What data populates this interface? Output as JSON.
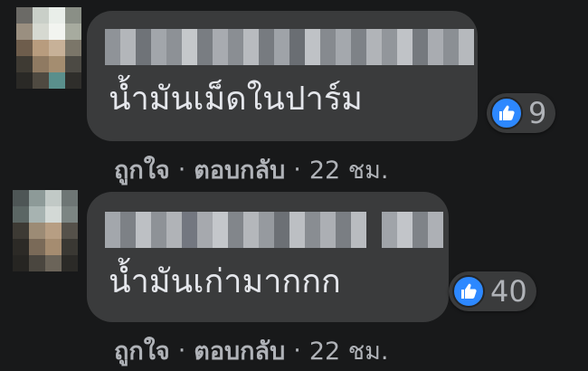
{
  "colors": {
    "background": "#18191a",
    "bubble": "#3a3b3c",
    "text": "#e4e6eb",
    "secondary_text": "#b0b3b8",
    "like_blue": "#2d88ff"
  },
  "comments": [
    {
      "text": "น้ำมันเม็ดในปาร์ม",
      "reaction_icon": "like-icon",
      "reaction_count": "9",
      "actions": {
        "like": "ถูกใจ",
        "separator": "·",
        "reply": "ตอบกลับ",
        "time": "22 ชม."
      }
    },
    {
      "text": "น้ำมันเก่ามากกก",
      "reaction_icon": "like-icon",
      "reaction_count": "40",
      "actions": {
        "like": "ถูกใจ",
        "separator": "·",
        "reply": "ตอบกลับ",
        "time": "22 ชม."
      }
    }
  ]
}
